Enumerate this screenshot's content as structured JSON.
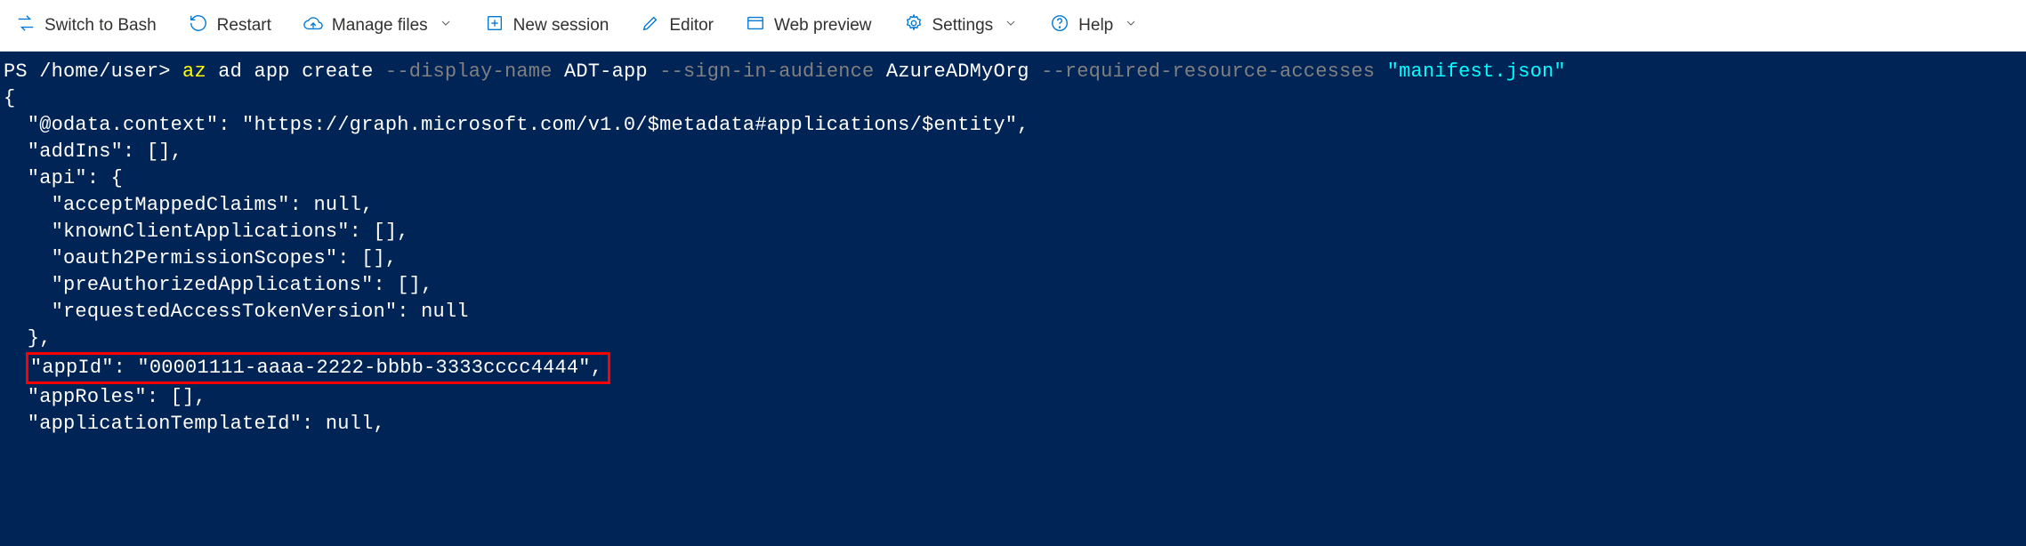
{
  "toolbar": {
    "switch": "Switch to Bash",
    "restart": "Restart",
    "manage_files": "Manage files",
    "new_session": "New session",
    "editor": "Editor",
    "web_preview": "Web preview",
    "settings": "Settings",
    "help": "Help"
  },
  "terminal": {
    "prompt_prefix": "PS ",
    "prompt_path": "/home/user>",
    "cmd_part1": " az",
    "cmd_part2": " ad app create ",
    "flag1": "--display-name",
    "val1": " ADT-app ",
    "flag2": "--sign-in-audience",
    "val2": " AzureADMyOrg ",
    "flag3": "--required-resource-accesses",
    "val3": " \"manifest.json\"",
    "out_line1": "{",
    "out_line2": "  \"@odata.context\": \"https://graph.microsoft.com/v1.0/$metadata#applications/$entity\",",
    "out_line3": "  \"addIns\": [],",
    "out_line4": "  \"api\": {",
    "out_line5": "    \"acceptMappedClaims\": null,",
    "out_line6": "    \"knownClientApplications\": [],",
    "out_line7": "    \"oauth2PermissionScopes\": [],",
    "out_line8": "    \"preAuthorizedApplications\": [],",
    "out_line9": "    \"requestedAccessTokenVersion\": null",
    "out_line10": "  },",
    "out_appid_inner": "\"appId\": \"00001111-aaaa-2222-bbbb-3333cccc4444\",",
    "out_line12": "  \"appRoles\": [],",
    "out_line13": "  \"applicationTemplateId\": null,"
  }
}
